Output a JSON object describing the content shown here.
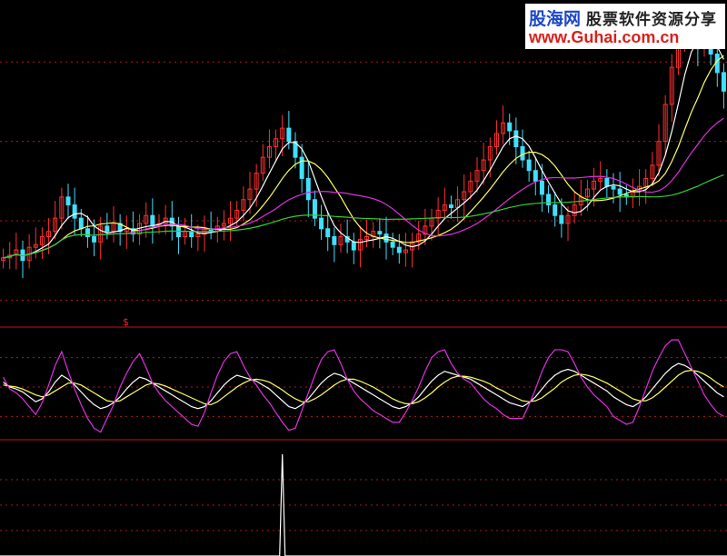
{
  "watermark": {
    "brand": "股海网",
    "description": "股票软件资源分享",
    "url": "www.Guhai.com.cn"
  },
  "marker_text": "$",
  "colors": {
    "background": "#000000",
    "up_candle": "#ff3030",
    "down_candle": "#40e0ff",
    "ma5": "#ffffff",
    "ma10": "#ffff60",
    "ma20": "#e030e0",
    "ma60": "#30d030",
    "kdj_k": "#ffffff",
    "kdj_d": "#ffff60",
    "kdj_j": "#e030e0",
    "divider": "#c01818",
    "grid": "#b01818",
    "volume_line": "#ffffff"
  },
  "chart_data": [
    {
      "type": "candlestick",
      "panel": "price",
      "y_range": [
        9.5,
        21.0
      ],
      "gridlines": [
        19,
        16,
        13,
        10
      ],
      "close": [
        11.6,
        11.7,
        11.9,
        11.5,
        12.0,
        12.1,
        12.4,
        12.6,
        13.1,
        13.9,
        13.6,
        13.1,
        12.7,
        12.4,
        12.2,
        12.8,
        12.6,
        12.9,
        12.6,
        12.7,
        12.5,
        12.9,
        13.2,
        12.8,
        12.9,
        13.1,
        12.8,
        12.4,
        12.6,
        12.4,
        12.5,
        12.7,
        12.6,
        12.8,
        12.9,
        13.1,
        13.4,
        13.8,
        14.2,
        14.8,
        15.4,
        15.8,
        16.1,
        16.5,
        16.0,
        15.4,
        14.6,
        13.8,
        13.1,
        12.7,
        12.4,
        12.1,
        12.4,
        12.2,
        11.9,
        12.3,
        12.4,
        12.6,
        12.5,
        12.2,
        12.0,
        11.8,
        11.9,
        12.2,
        12.5,
        12.8,
        13.1,
        13.4,
        13.6,
        13.5,
        13.8,
        14.1,
        14.5,
        14.9,
        15.3,
        15.8,
        16.3,
        16.7,
        16.4,
        15.8,
        15.3,
        14.9,
        14.5,
        14.0,
        13.6,
        13.2,
        12.9,
        13.2,
        13.6,
        13.9,
        14.2,
        14.5,
        14.6,
        14.3,
        14.2,
        14.0,
        13.9,
        14.1,
        14.3,
        14.6,
        15.1,
        16.0,
        17.4,
        18.8,
        19.8,
        20.6,
        20.3,
        19.5,
        20.2,
        19.3,
        18.6,
        17.9
      ],
      "ma_series": [
        "MA5",
        "MA10",
        "MA20",
        "MA60"
      ]
    },
    {
      "type": "line",
      "panel": "KDJ",
      "series": [
        {
          "name": "K",
          "values": [
            55,
            50,
            48,
            45,
            40,
            35,
            38,
            45,
            55,
            62,
            58,
            52,
            45,
            38,
            32,
            28,
            30,
            34,
            40,
            48,
            55,
            60,
            58,
            54,
            50,
            46,
            42,
            38,
            34,
            30,
            28,
            30,
            36,
            44,
            52,
            58,
            62,
            60,
            58,
            56,
            52,
            48,
            42,
            36,
            30,
            28,
            32,
            38,
            46,
            54,
            60,
            64,
            62,
            58,
            54,
            50,
            46,
            42,
            38,
            34,
            30,
            28,
            30,
            34,
            40,
            48,
            56,
            62,
            66,
            64,
            62,
            60,
            58,
            54,
            50,
            46,
            42,
            38,
            34,
            32,
            30,
            34,
            40,
            48,
            56,
            62,
            66,
            68,
            66,
            62,
            58,
            54,
            50,
            46,
            40,
            36,
            32,
            30,
            34,
            40,
            48,
            56,
            64,
            70,
            74,
            72,
            68,
            62,
            56,
            50,
            44,
            40
          ]
        },
        {
          "name": "D",
          "values": [
            52,
            51,
            50,
            48,
            45,
            42,
            40,
            42,
            46,
            50,
            54,
            54,
            52,
            48,
            44,
            40,
            36,
            35,
            36,
            40,
            44,
            48,
            52,
            54,
            53,
            51,
            48,
            45,
            42,
            39,
            36,
            33,
            32,
            35,
            40,
            45,
            50,
            54,
            57,
            58,
            57,
            55,
            51,
            47,
            42,
            38,
            35,
            35,
            38,
            42,
            47,
            52,
            56,
            58,
            58,
            56,
            53,
            50,
            46,
            42,
            38,
            35,
            33,
            33,
            35,
            39,
            44,
            50,
            55,
            59,
            61,
            61,
            60,
            58,
            56,
            53,
            49,
            46,
            42,
            39,
            36,
            35,
            36,
            39,
            44,
            49,
            55,
            59,
            62,
            63,
            62,
            60,
            57,
            54,
            50,
            46,
            42,
            38,
            36,
            36,
            39,
            44,
            50,
            56,
            62,
            66,
            67,
            66,
            63,
            59,
            54,
            50
          ]
        },
        {
          "name": "J",
          "values": [
            60,
            48,
            44,
            38,
            30,
            22,
            34,
            52,
            72,
            86,
            66,
            48,
            32,
            18,
            8,
            4,
            18,
            32,
            50,
            64,
            76,
            84,
            70,
            54,
            44,
            36,
            30,
            24,
            18,
            12,
            10,
            24,
            44,
            62,
            76,
            84,
            86,
            72,
            60,
            52,
            42,
            34,
            24,
            14,
            6,
            8,
            26,
            44,
            62,
            78,
            86,
            88,
            74,
            58,
            46,
            38,
            32,
            26,
            22,
            18,
            14,
            14,
            24,
            36,
            50,
            66,
            80,
            86,
            88,
            74,
            64,
            58,
            54,
            46,
            38,
            32,
            28,
            22,
            18,
            18,
            18,
            32,
            48,
            66,
            80,
            88,
            88,
            86,
            74,
            60,
            50,
            42,
            36,
            30,
            20,
            16,
            12,
            14,
            30,
            48,
            66,
            80,
            92,
            98,
            98,
            84,
            70,
            56,
            42,
            32,
            24,
            20
          ]
        }
      ],
      "y_range": [
        0,
        100
      ],
      "gridlines": [
        80,
        50,
        20
      ]
    },
    {
      "type": "line",
      "panel": "volume_spike",
      "series": [
        {
          "name": "signal",
          "values": [
            0,
            0,
            0,
            0,
            0,
            0,
            0,
            0,
            0,
            0,
            0,
            0,
            0,
            0,
            0,
            0,
            0,
            0,
            0,
            0,
            0,
            0,
            0,
            0,
            0,
            0,
            0,
            0,
            0,
            0,
            0,
            0,
            0,
            0,
            0,
            0,
            0,
            0,
            0,
            0,
            0,
            0,
            0,
            0,
            0,
            0,
            0,
            0,
            0,
            0,
            0,
            0,
            0,
            0,
            0,
            0,
            0,
            0,
            0,
            0,
            0,
            0,
            0,
            0,
            0,
            0,
            0,
            0,
            0,
            0,
            0,
            0,
            0,
            0,
            0,
            0,
            0,
            0,
            0,
            0,
            0,
            0,
            0,
            0,
            0,
            0,
            0,
            0,
            0,
            0,
            0,
            0,
            0,
            0,
            0,
            0,
            0,
            0,
            0,
            0,
            0,
            0,
            0,
            0,
            0,
            0,
            0,
            0,
            0,
            0,
            0,
            0
          ]
        }
      ],
      "spike_index": 43,
      "spike_value": 100,
      "y_range": [
        0,
        100
      ],
      "gridlines": [
        75,
        50,
        25
      ]
    }
  ]
}
